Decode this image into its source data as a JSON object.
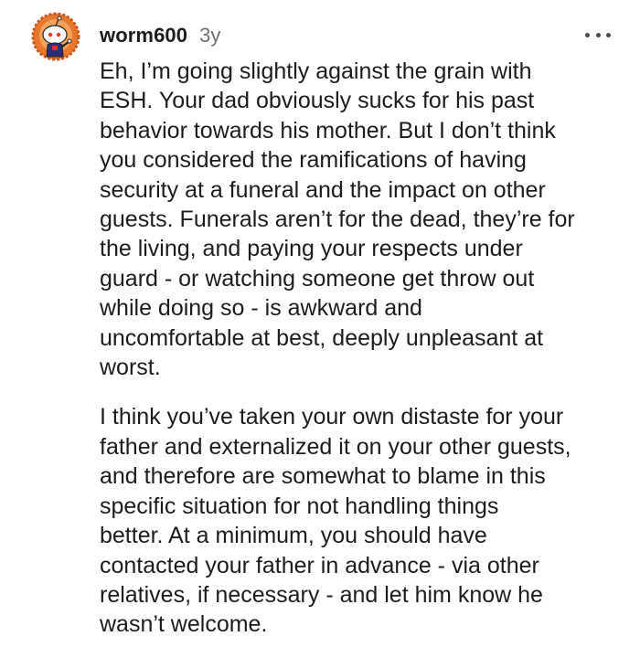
{
  "comment": {
    "author": "worm600",
    "age": "3y",
    "avatar_icon": "snoo-avatar-icon",
    "menu_icon": "more-options-icon",
    "paragraphs": [
      "Eh, I’m going slightly against the grain with\nESH. Your dad obviously sucks for his past\nbehavior towards his mother. But I don’t think\nyou considered the ramifications of having\nsecurity at a funeral and the impact on other\nguests. Funerals aren’t for the dead, they’re for\nthe living, and paying your respects under\nguard - or watching someone get throw out\nwhile doing so - is awkward and\nuncomfortable at best, deeply unpleasant at\nworst.",
      "I think you’ve taken your own distaste for your\nfather and externalized it on your other guests,\nand therefore are somewhat to blame in this\nspecific situation for not handling things\nbetter. At a minimum, you should have\ncontacted your father in advance - via other\nrelatives, if necessary - and let him know he\nwasn’t welcome."
    ]
  },
  "colors": {
    "text": "#1c1c1c",
    "meta": "#6d6f71",
    "avatar_ring": "#e8762b"
  }
}
